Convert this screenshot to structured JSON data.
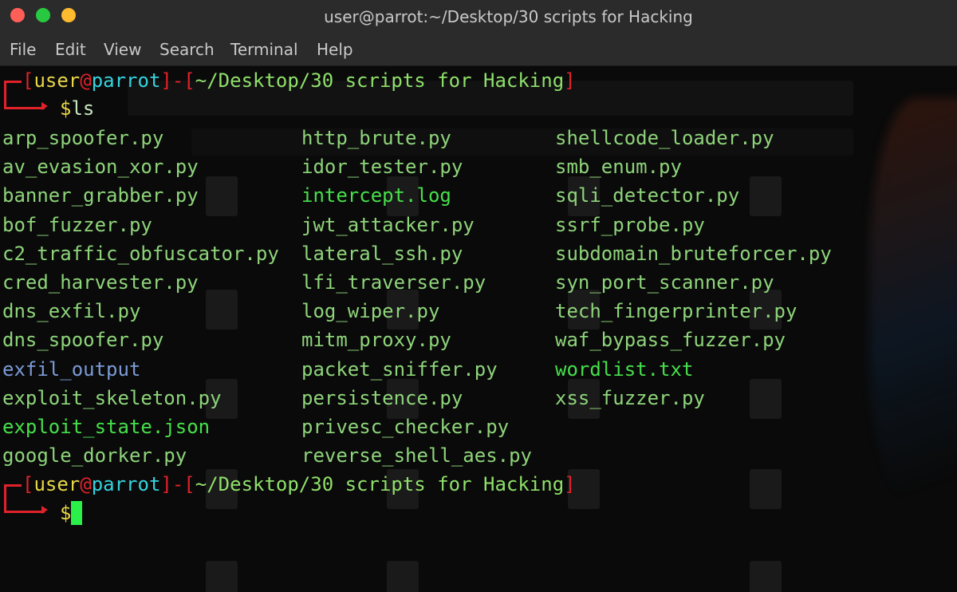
{
  "window": {
    "title": "user@parrot:~/Desktop/30 scripts for Hacking",
    "buttons": {
      "close_color": "#ff5f57",
      "minimize_color": "#28c840",
      "maximize_color": "#febc2e"
    }
  },
  "menu": [
    "File",
    "Edit",
    "View",
    "Search",
    "Terminal",
    "Help"
  ],
  "prompt": {
    "user": "user",
    "at": "@",
    "host": "parrot",
    "path": "~/Desktop/30 scripts for Hacking",
    "symbol": "$"
  },
  "command": "ls",
  "files": {
    "col1": [
      {
        "name": "arp_spoofer.py",
        "type": "script"
      },
      {
        "name": "av_evasion_xor.py",
        "type": "script"
      },
      {
        "name": "banner_grabber.py",
        "type": "script"
      },
      {
        "name": "bof_fuzzer.py",
        "type": "script"
      },
      {
        "name": "c2_traffic_obfuscator.py",
        "type": "script"
      },
      {
        "name": "cred_harvester.py",
        "type": "script"
      },
      {
        "name": "dns_exfil.py",
        "type": "script"
      },
      {
        "name": "dns_spoofer.py",
        "type": "script"
      },
      {
        "name": "exfil_output",
        "type": "directory"
      },
      {
        "name": "exploit_skeleton.py",
        "type": "script"
      },
      {
        "name": "exploit_state.json",
        "type": "data"
      },
      {
        "name": "google_dorker.py",
        "type": "script"
      }
    ],
    "col2": [
      {
        "name": "http_brute.py",
        "type": "script"
      },
      {
        "name": "idor_tester.py",
        "type": "script"
      },
      {
        "name": "intercept.log",
        "type": "data"
      },
      {
        "name": "jwt_attacker.py",
        "type": "script"
      },
      {
        "name": "lateral_ssh.py",
        "type": "script"
      },
      {
        "name": "lfi_traverser.py",
        "type": "script"
      },
      {
        "name": "log_wiper.py",
        "type": "script"
      },
      {
        "name": "mitm_proxy.py",
        "type": "script"
      },
      {
        "name": "packet_sniffer.py",
        "type": "script"
      },
      {
        "name": "persistence.py",
        "type": "script"
      },
      {
        "name": "privesc_checker.py",
        "type": "script"
      },
      {
        "name": "reverse_shell_aes.py",
        "type": "script"
      }
    ],
    "col3": [
      {
        "name": "shellcode_loader.py",
        "type": "script"
      },
      {
        "name": "smb_enum.py",
        "type": "script"
      },
      {
        "name": "sqli_detector.py",
        "type": "script"
      },
      {
        "name": "ssrf_probe.py",
        "type": "script"
      },
      {
        "name": "subdomain_bruteforcer.py",
        "type": "script"
      },
      {
        "name": "syn_port_scanner.py",
        "type": "script"
      },
      {
        "name": "tech_fingerprinter.py",
        "type": "script"
      },
      {
        "name": "waf_bypass_fuzzer.py",
        "type": "script"
      },
      {
        "name": "wordlist.txt",
        "type": "data"
      },
      {
        "name": "xss_fuzzer.py",
        "type": "script"
      }
    ]
  },
  "colors": {
    "script": "#8ed47a",
    "directory": "#7b9bd6",
    "data": "#46e04a",
    "prompt_bracket": "#e0222a",
    "prompt_user": "#e8d648",
    "prompt_host": "#35d3de",
    "cursor": "#2bf04a"
  }
}
